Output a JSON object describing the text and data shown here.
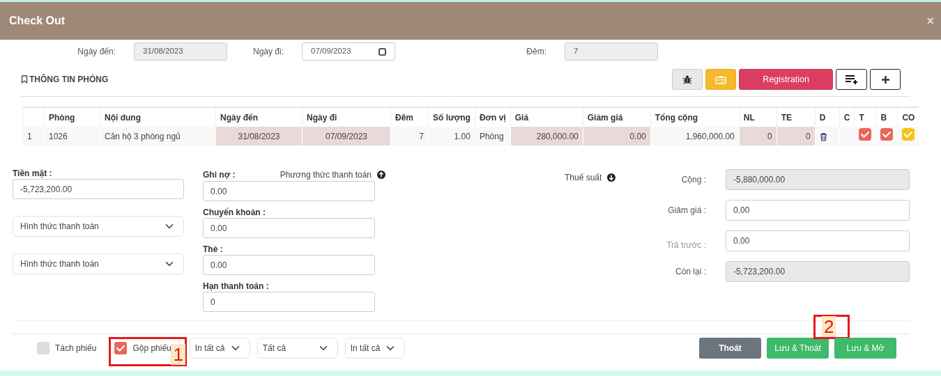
{
  "dialog": {
    "title": "Check Out",
    "close_label": "×"
  },
  "stay_fields": [
    {
      "label": "Ngày đến:",
      "value": "31/08/2023",
      "kind": "readonly"
    },
    {
      "label": "Ngày đi:",
      "value": "07/09/2023",
      "kind": "date"
    },
    {
      "label": "Đêm:",
      "value": "7",
      "kind": "readonly"
    }
  ],
  "room_section": {
    "title": "THÔNG TIN PHÒNG",
    "toolbar": [
      {
        "kind": "bug"
      },
      {
        "kind": "card"
      },
      {
        "kind": "text",
        "label": "Registration"
      },
      {
        "kind": "list-add"
      },
      {
        "kind": "plus"
      }
    ]
  },
  "table": {
    "columns": [
      {
        "kind": "index"
      },
      {
        "label": "Phòng",
        "kind": "text"
      },
      {
        "label": "Nội dung",
        "kind": "text"
      },
      {
        "label": "Ngày đến",
        "kind": "center"
      },
      {
        "label": "Ngày đi",
        "kind": "center"
      },
      {
        "label": "Đêm",
        "kind": "num"
      },
      {
        "label": "Số lượng",
        "kind": "num"
      },
      {
        "label": "Đơn vị",
        "kind": "text"
      },
      {
        "label": "Giá",
        "kind": "num"
      },
      {
        "label": "Giảm giá",
        "kind": "num"
      },
      {
        "label": "Tổng cộng",
        "kind": "num"
      },
      {
        "label": "NL",
        "kind": "num"
      },
      {
        "label": "TE",
        "kind": "num"
      },
      {
        "label": "D",
        "kind": "delete"
      },
      {
        "label": "C",
        "kind": "empty"
      },
      {
        "label": "T",
        "kind": "check"
      },
      {
        "label": "B",
        "kind": "check"
      },
      {
        "label": "CO",
        "kind": "check"
      }
    ],
    "rows": [
      {
        "cells": [
          {
            "text": "1",
            "editable": false
          },
          {
            "text": "1026",
            "editable": false
          },
          {
            "text": "Căn hộ 3 phòng ngủ",
            "editable": false
          },
          {
            "text": "31/08/2023",
            "editable": true
          },
          {
            "text": "07/09/2023",
            "editable": true
          },
          {
            "text": "7",
            "editable": false
          },
          {
            "text": "1.00",
            "editable": false
          },
          {
            "text": "Phòng",
            "editable": false
          },
          {
            "text": "280,000.00",
            "editable": true
          },
          {
            "text": "0.00",
            "editable": true
          },
          {
            "text": "1,960,000.00",
            "editable": false
          },
          {
            "text": "0",
            "editable": true
          },
          {
            "text": "0",
            "editable": true
          }
        ],
        "checks": [
          {
            "checked": true,
            "color": "#e8665a"
          },
          {
            "checked": true,
            "color": "#e8665a"
          },
          {
            "checked": true,
            "color": "#f2c416"
          }
        ]
      }
    ]
  },
  "payment": {
    "cash": {
      "label": "Tiền mặt :",
      "value": "-5,723,200.00"
    },
    "method_selects": [
      {
        "value": "Hình thức thanh toán"
      },
      {
        "value": "Hình thức thanh toán"
      }
    ],
    "method_toggle": {
      "label": "Phương thức thanh toán",
      "expanded": true
    },
    "fields": [
      {
        "label": "Ghi nợ :",
        "value": "0.00"
      },
      {
        "label": "Chuyển khoản :",
        "value": "0.00"
      },
      {
        "label": "Thẻ :",
        "value": "0.00"
      },
      {
        "label": "Hạn thanh toán :",
        "value": "0"
      }
    ],
    "tax_toggle": {
      "label": "Thuế suất",
      "expanded": false
    }
  },
  "summary": [
    {
      "label": "Cộng :",
      "value": "-5,880,000.00",
      "readonly": true,
      "muted": false
    },
    {
      "label": "Giảm giá :",
      "value": "0.00",
      "readonly": false,
      "muted": false
    },
    {
      "label": "Trả trước :",
      "value": "0.00",
      "readonly": false,
      "muted": true
    },
    {
      "label": "Còn lại :",
      "value": "-5,723,200.00",
      "readonly": true,
      "muted": false
    }
  ],
  "footer": {
    "options": [
      {
        "label": "Tách phiếu",
        "checked": false
      },
      {
        "label": "Gộp phiếu",
        "checked": true,
        "callout": "1"
      }
    ],
    "selects": [
      {
        "value": "In tất cả"
      },
      {
        "value": "Tất cả"
      },
      {
        "value": "In tất cả"
      }
    ],
    "buttons": [
      {
        "label": "Thoát",
        "kind": "secondary"
      },
      {
        "label": "Lưu & Thoát",
        "kind": "success",
        "callout": "2"
      },
      {
        "label": "Lưu & Mở",
        "kind": "success"
      }
    ]
  }
}
